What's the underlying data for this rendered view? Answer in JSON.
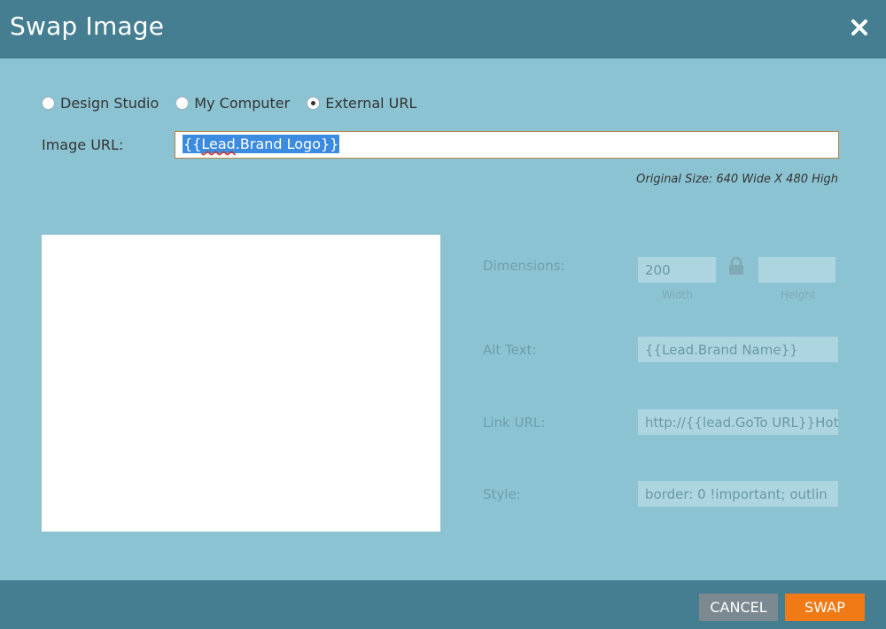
{
  "dialog": {
    "title": "Swap Image",
    "close_icon": "close-icon"
  },
  "source_options": [
    {
      "label": "Design Studio",
      "selected": false
    },
    {
      "label": "My Computer",
      "selected": false
    },
    {
      "label": "External URL",
      "selected": true
    }
  ],
  "image_url": {
    "label": "Image URL:",
    "value": "{{Lead.Brand Logo}}",
    "value_prefix": "{{",
    "value_misspelled": "Lead",
    "value_suffix": ".Brand Logo}}"
  },
  "original_size": "Original Size: 640 Wide X 480 High",
  "properties": {
    "dimensions": {
      "label": "Dimensions:",
      "width_value": "200",
      "height_value": "",
      "width_label": "Width",
      "height_label": "Height",
      "lock_icon": "lock-icon"
    },
    "alt_text": {
      "label": "Alt Text:",
      "value": "{{Lead.Brand Name}}"
    },
    "link_url": {
      "label": "Link URL:",
      "value": "http://{{lead.GoTo URL}}Hot"
    },
    "style": {
      "label": "Style:",
      "value": "border: 0 !important; outlin"
    }
  },
  "footer": {
    "cancel_label": "CANCEL",
    "swap_label": "SWAP"
  },
  "colors": {
    "header": "#467e91",
    "body": "#8cc3d2",
    "swap_button": "#f07a15",
    "cancel_button": "#7c8990",
    "selection": "#3b8be0"
  }
}
